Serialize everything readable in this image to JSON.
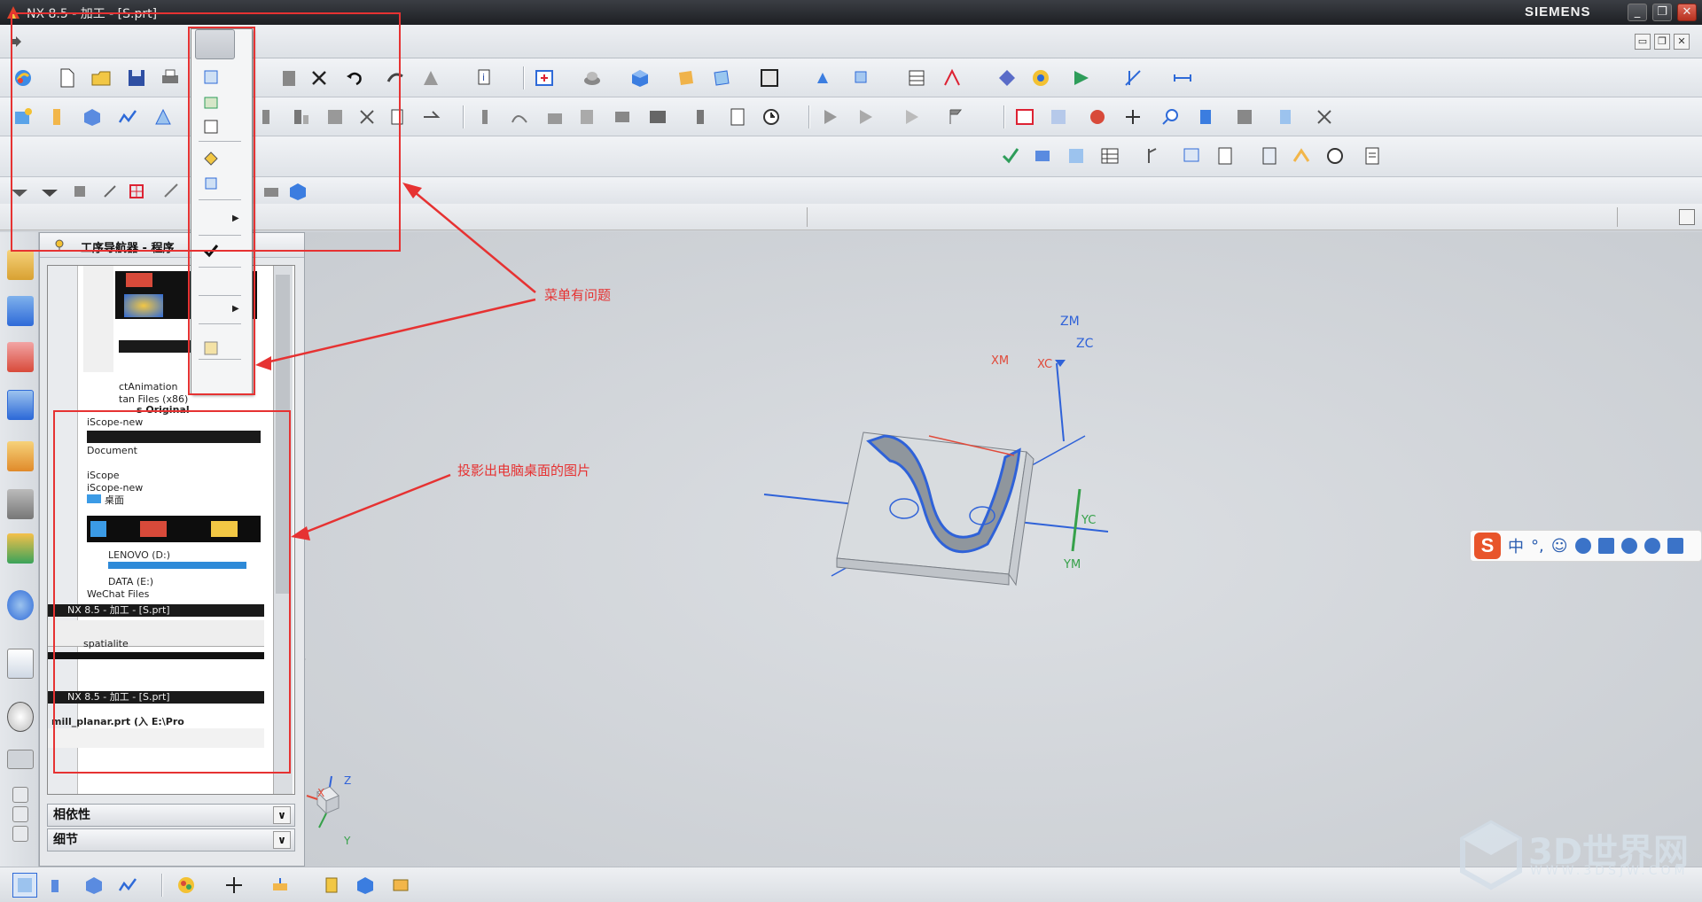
{
  "window": {
    "title": "NX 8.5 - 加工 - [S.prt]",
    "brand": "SIEMENS",
    "minimize_glyph": "_",
    "restore_glyph": "❐",
    "close_glyph": "✕"
  },
  "navigator": {
    "title": "工序导航器 - 程序",
    "glitch_texts": [
      "ctAnimation",
      "tan Files (x86)",
      "s Original",
      "iScope-new",
      "Document",
      "iScope",
      "iScope-new",
      "桌面",
      "LENOVO (D:)",
      "DATA (E:)",
      "WeChat Files",
      "NX 8.5 - 加工 - [S.prt]",
      "spatialite",
      "NX 8.5 - 加工 - [S.prt]",
      "mill_planar.prt (入 E:\\Pro"
    ]
  },
  "panels": {
    "dependency": "相依性",
    "detail": "细节"
  },
  "annotations": {
    "menu_issue": "菜单有问题",
    "desktop_projection": "投影出电脑桌面的图片"
  },
  "axes": {
    "zm": "ZM",
    "zc": "ZC",
    "xm": "XM",
    "xc": "XC",
    "yc": "YC",
    "ym": "YM",
    "triad_x": "X",
    "triad_y": "Y",
    "triad_z": "Z"
  },
  "ime": {
    "logo": "S",
    "labels": [
      "中",
      "°,",
      "☺"
    ]
  },
  "watermark": {
    "text": "3D世界网",
    "url": "WWW.3DSJW.COM"
  },
  "colors": {
    "annotation": "#e63232",
    "titlebar": "#2a2c30",
    "accent_blue": "#2f62d8"
  }
}
